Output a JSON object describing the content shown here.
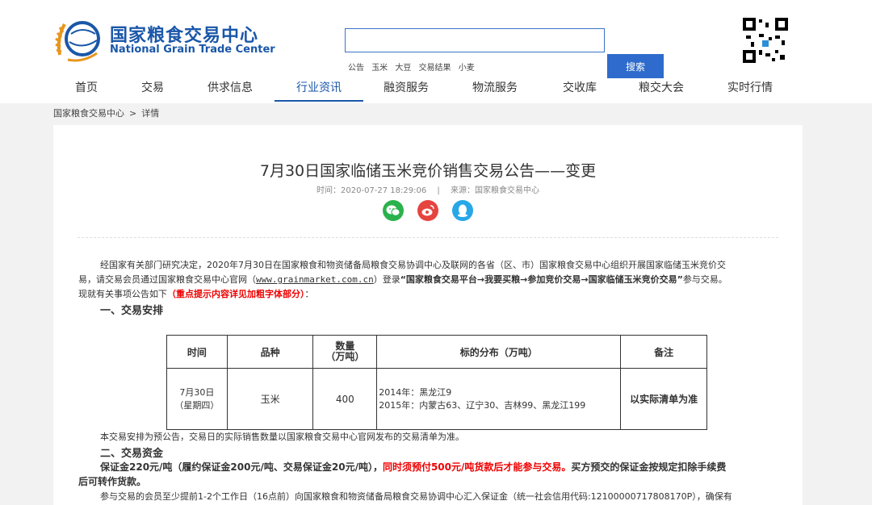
{
  "brand": {
    "cn": "国家粮食交易中心",
    "en": "National Grain Trade Center"
  },
  "search": {
    "button": "搜索",
    "hotwords": [
      "公告",
      "玉米",
      "大豆",
      "交易结果",
      "小麦"
    ]
  },
  "nav": [
    "首页",
    "交易",
    "供求信息",
    "行业资讯",
    "融资服务",
    "物流服务",
    "交收库",
    "粮交大会",
    "实时行情"
  ],
  "breadcrumb": {
    "home": "国家粮食交易中心",
    "sep": ">",
    "current": "详情"
  },
  "article": {
    "title": "7月30日国家临储玉米竞价销售交易公告——变更",
    "time": "时间：2020-07-27 18:29:06",
    "meta_sep": "|",
    "source": "来源：国家粮食交易中心",
    "intro_1": "经国家有关部门研究决定，2020年7月30日在国家粮食和物资储备局粮食交易协调中心及联网的各省（区、市）国家粮食交易中心组织开展国家临储玉米竞价交",
    "intro_2a": "易，请交易会员通过国家粮食交易中心官网（",
    "intro_2_url": "www.grainmarket.com.cn",
    "intro_2b": "）登录",
    "intro_2_path": "“国家粮食交易平台→我要买粮→参加竞价交易→国家临储玉米竞价交易”",
    "intro_2c": "参与交易。",
    "intro_3a": "现就有关事项公告如下",
    "intro_3_red": "（重点提示内容详见加粗字体部分）",
    "intro_3b": "：",
    "section1": "一、交易安排",
    "table": {
      "headers": [
        "时间",
        "品种",
        "数量\n（万吨）",
        "标的分布（万吨）",
        "备注"
      ],
      "row": {
        "time": "7月30日\n（星期四）",
        "variety": "玉米",
        "qty": "400",
        "dist_1": "2014年：黑龙江9",
        "dist_2": "2015年：内蒙古63、辽宁30、吉林99、黑龙江199",
        "note": "以实际清单为准"
      }
    },
    "after_table": "本交易安排为预公告，交易日的实际销售数量以国家粮食交易中心官网发布的交易清单为准。",
    "section2": "二、交易资金",
    "fund_1a": "保证金220元/吨（履约保证金200元/吨、交易保证金20元/吨），",
    "fund_1_red": "同时须预付500元/吨货款后才能参与交易。",
    "fund_1b": "买方预交的保证金按规定扣除手续费",
    "fund_2": "后可转作货款。",
    "fund_3": "参与交易的会员至少提前1-2个工作日（16点前）向国家粮食和物资储备局粮食交易协调中心汇入保证金（统一社会信用代码:12100000717808170P），确保有"
  }
}
